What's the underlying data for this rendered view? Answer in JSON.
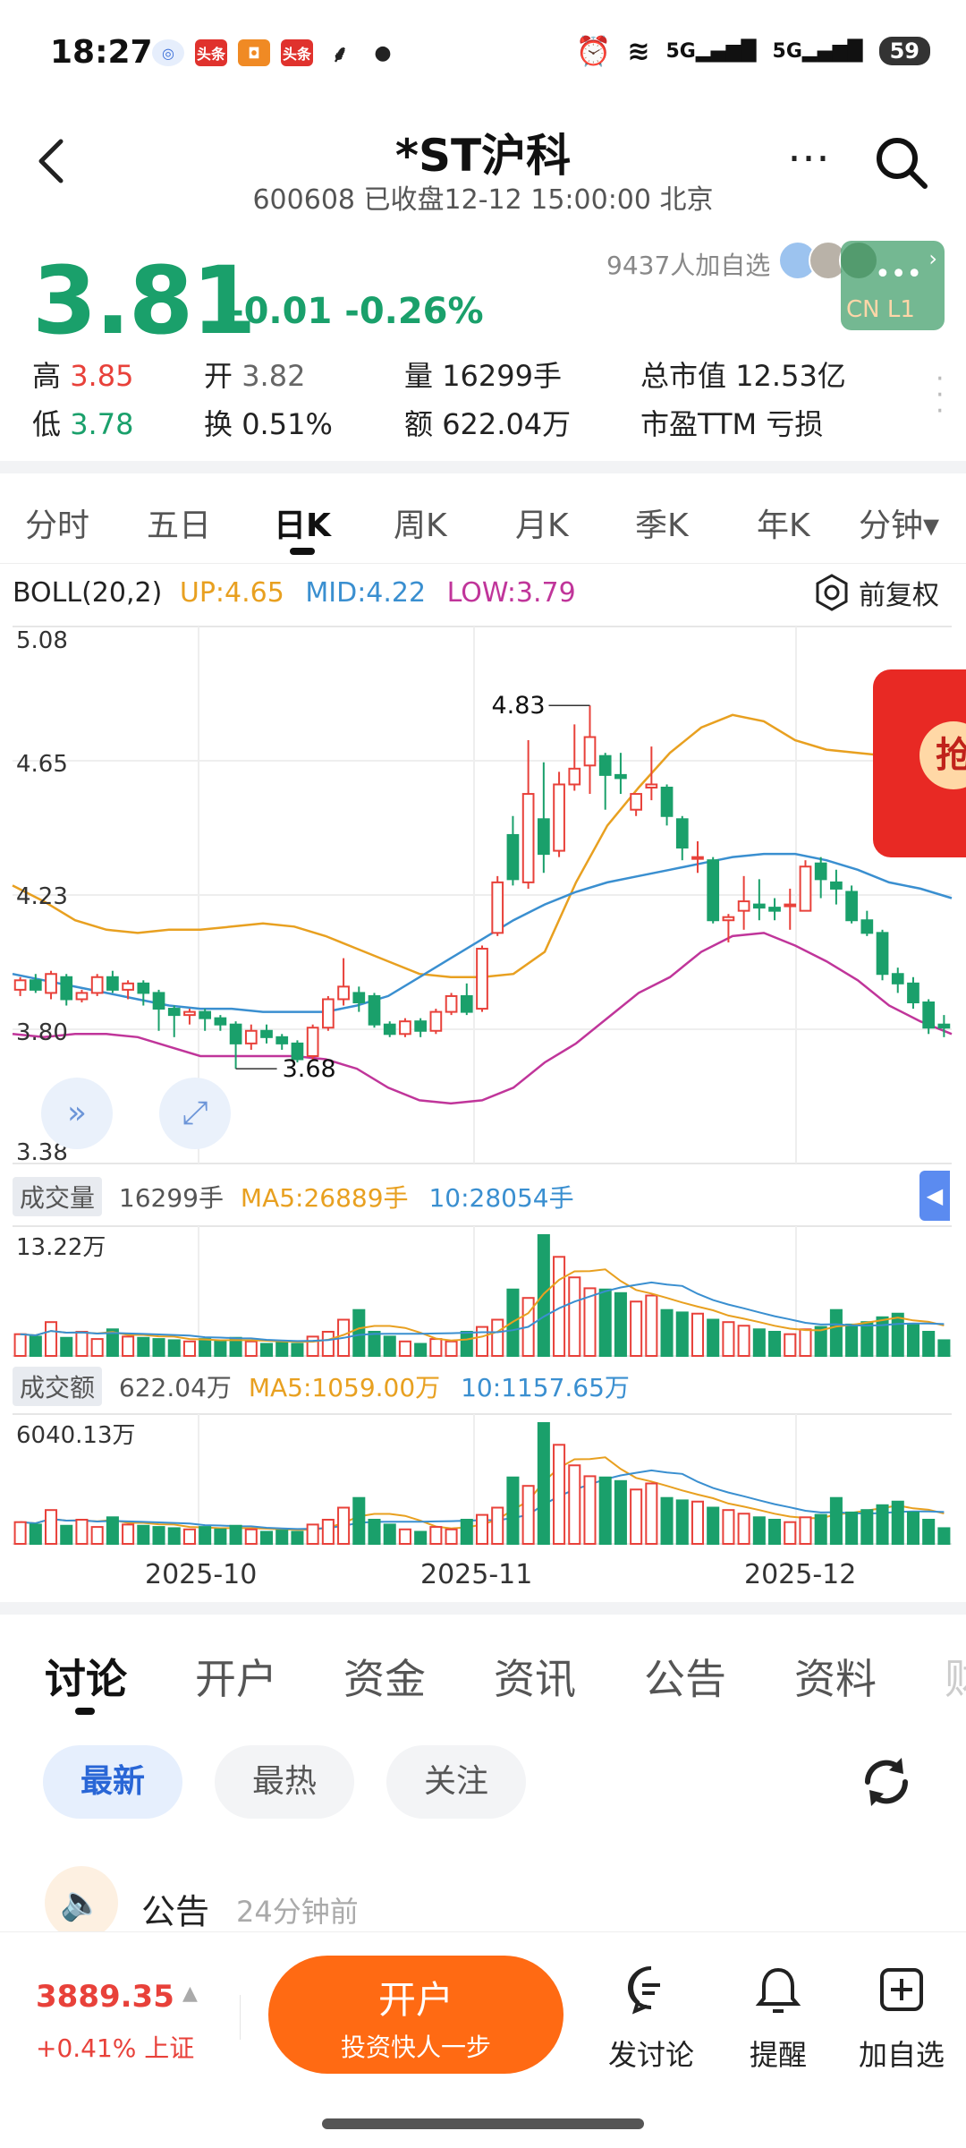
{
  "status_bar": {
    "time": "18:27",
    "app_icons": [
      "头条",
      "头条"
    ],
    "signal": [
      "5G",
      "5G"
    ],
    "battery": "59"
  },
  "header": {
    "title": "*ST沪科",
    "subtitle": "600608 已收盘12-12 15:00:00 北京"
  },
  "quote": {
    "price": "3.81",
    "change": "-0.01 -0.26%",
    "followers": "9437人加自选",
    "widget_label": "CN L1",
    "high_label": "高",
    "high": "3.85",
    "low_label": "低",
    "low": "3.78",
    "open_label": "开",
    "open": "3.82",
    "turnover_label": "换",
    "turnover": "0.51%",
    "volume_label": "量",
    "volume": "16299手",
    "amount_label": "额",
    "amount": "622.04万",
    "mcap_label": "总市值",
    "mcap": "12.53亿",
    "pe_label": "市盈TTM",
    "pe": "亏损"
  },
  "period_tabs": [
    "分时",
    "五日",
    "日K",
    "周K",
    "月K",
    "季K",
    "年K",
    "分钟▾"
  ],
  "chart_header": {
    "boll": "BOLL(20,2)",
    "up": "UP:4.65",
    "mid": "MID:4.22",
    "low": "LOW:3.79",
    "adjust": "前复权"
  },
  "chart_labels": {
    "y_ticks": [
      "5.08",
      "4.65",
      "4.23",
      "3.80",
      "3.38"
    ],
    "max_note": "4.83",
    "min_note": "3.68",
    "vol_title": "成交量",
    "vol_value": "16299手",
    "vol_ma5": "MA5:26889手",
    "vol_ma10": "10:28054手",
    "vol_max": "13.22万",
    "amt_title": "成交额",
    "amt_value": "622.04万",
    "amt_ma5": "MA5:1059.00万",
    "amt_ma10": "10:1157.65万",
    "amt_max": "6040.13万",
    "x_dates": [
      "2025-10",
      "2025-11",
      "2025-12"
    ]
  },
  "colors": {
    "up": "#e8413a",
    "down": "#1aa06b",
    "boll_up": "#e8a020",
    "boll_mid": "#3a8fd0",
    "boll_low": "#c0359a",
    "accent": "#ff6a13"
  },
  "chart_data": {
    "type": "candlestick",
    "indicator": "BOLL(20,2)",
    "ylim": [
      3.38,
      5.08
    ],
    "candles": [
      {
        "o": 3.93,
        "c": 3.96,
        "h": 3.97,
        "l": 3.91
      },
      {
        "o": 3.96,
        "c": 3.93,
        "h": 3.98,
        "l": 3.92
      },
      {
        "o": 3.92,
        "c": 3.98,
        "h": 3.99,
        "l": 3.9
      },
      {
        "o": 3.97,
        "c": 3.9,
        "h": 3.98,
        "l": 3.88
      },
      {
        "o": 3.9,
        "c": 3.92,
        "h": 3.93,
        "l": 3.89
      },
      {
        "o": 3.92,
        "c": 3.97,
        "h": 3.98,
        "l": 3.91
      },
      {
        "o": 3.97,
        "c": 3.93,
        "h": 3.99,
        "l": 3.92
      },
      {
        "o": 3.93,
        "c": 3.95,
        "h": 3.96,
        "l": 3.9
      },
      {
        "o": 3.95,
        "c": 3.92,
        "h": 3.96,
        "l": 3.88
      },
      {
        "o": 3.92,
        "c": 3.87,
        "h": 3.93,
        "l": 3.8
      },
      {
        "o": 3.87,
        "c": 3.85,
        "h": 3.88,
        "l": 3.78
      },
      {
        "o": 3.85,
        "c": 3.86,
        "h": 3.87,
        "l": 3.82
      },
      {
        "o": 3.86,
        "c": 3.84,
        "h": 3.87,
        "l": 3.8
      },
      {
        "o": 3.84,
        "c": 3.82,
        "h": 3.85,
        "l": 3.8
      },
      {
        "o": 3.82,
        "c": 3.76,
        "h": 3.83,
        "l": 3.68
      },
      {
        "o": 3.76,
        "c": 3.8,
        "h": 3.82,
        "l": 3.74
      },
      {
        "o": 3.8,
        "c": 3.78,
        "h": 3.82,
        "l": 3.76
      },
      {
        "o": 3.78,
        "c": 3.76,
        "h": 3.79,
        "l": 3.74
      },
      {
        "o": 3.76,
        "c": 3.71,
        "h": 3.77,
        "l": 3.7
      },
      {
        "o": 3.72,
        "c": 3.81,
        "h": 3.82,
        "l": 3.71
      },
      {
        "o": 3.81,
        "c": 3.9,
        "h": 3.91,
        "l": 3.8
      },
      {
        "o": 3.9,
        "c": 3.94,
        "h": 4.03,
        "l": 3.88
      },
      {
        "o": 3.92,
        "c": 3.89,
        "h": 3.94,
        "l": 3.86
      },
      {
        "o": 3.91,
        "c": 3.82,
        "h": 3.92,
        "l": 3.81
      },
      {
        "o": 3.82,
        "c": 3.79,
        "h": 3.83,
        "l": 3.78
      },
      {
        "o": 3.79,
        "c": 3.83,
        "h": 3.84,
        "l": 3.78
      },
      {
        "o": 3.83,
        "c": 3.8,
        "h": 3.84,
        "l": 3.78
      },
      {
        "o": 3.8,
        "c": 3.86,
        "h": 3.87,
        "l": 3.79
      },
      {
        "o": 3.86,
        "c": 3.91,
        "h": 3.92,
        "l": 3.85
      },
      {
        "o": 3.91,
        "c": 3.86,
        "h": 3.95,
        "l": 3.85
      },
      {
        "o": 3.87,
        "c": 4.06,
        "h": 4.07,
        "l": 3.86
      },
      {
        "o": 4.11,
        "c": 4.27,
        "h": 4.29,
        "l": 4.1
      },
      {
        "o": 4.42,
        "c": 4.28,
        "h": 4.48,
        "l": 4.26
      },
      {
        "o": 4.27,
        "c": 4.55,
        "h": 4.72,
        "l": 4.25
      },
      {
        "o": 4.47,
        "c": 4.36,
        "h": 4.65,
        "l": 4.3
      },
      {
        "o": 4.37,
        "c": 4.58,
        "h": 4.62,
        "l": 4.35
      },
      {
        "o": 4.58,
        "c": 4.63,
        "h": 4.77,
        "l": 4.56
      },
      {
        "o": 4.64,
        "c": 4.73,
        "h": 4.83,
        "l": 4.55
      },
      {
        "o": 4.67,
        "c": 4.61,
        "h": 4.68,
        "l": 4.5
      },
      {
        "o": 4.61,
        "c": 4.6,
        "h": 4.68,
        "l": 4.55
      },
      {
        "o": 4.5,
        "c": 4.55,
        "h": 4.55,
        "l": 4.48
      },
      {
        "o": 4.57,
        "c": 4.58,
        "h": 4.7,
        "l": 4.53
      },
      {
        "o": 4.57,
        "c": 4.48,
        "h": 4.58,
        "l": 4.45
      },
      {
        "o": 4.47,
        "c": 4.38,
        "h": 4.48,
        "l": 4.34
      },
      {
        "o": 4.35,
        "c": 4.35,
        "h": 4.4,
        "l": 4.3
      },
      {
        "o": 4.34,
        "c": 4.15,
        "h": 4.35,
        "l": 4.14
      },
      {
        "o": 4.15,
        "c": 4.16,
        "h": 4.17,
        "l": 4.08
      },
      {
        "o": 4.18,
        "c": 4.21,
        "h": 4.29,
        "l": 4.12
      },
      {
        "o": 4.2,
        "c": 4.19,
        "h": 4.28,
        "l": 4.15
      },
      {
        "o": 4.19,
        "c": 4.18,
        "h": 4.22,
        "l": 4.15
      },
      {
        "o": 4.2,
        "c": 4.2,
        "h": 4.25,
        "l": 4.12
      },
      {
        "o": 4.18,
        "c": 4.32,
        "h": 4.34,
        "l": 4.18
      },
      {
        "o": 4.33,
        "c": 4.28,
        "h": 4.35,
        "l": 4.22
      },
      {
        "o": 4.27,
        "c": 4.25,
        "h": 4.31,
        "l": 4.2
      },
      {
        "o": 4.24,
        "c": 4.15,
        "h": 4.26,
        "l": 4.14
      },
      {
        "o": 4.15,
        "c": 4.11,
        "h": 4.18,
        "l": 4.1
      },
      {
        "o": 4.11,
        "c": 3.98,
        "h": 4.12,
        "l": 3.96
      },
      {
        "o": 3.98,
        "c": 3.95,
        "h": 4.0,
        "l": 3.92
      },
      {
        "o": 3.95,
        "c": 3.89,
        "h": 3.97,
        "l": 3.87
      },
      {
        "o": 3.89,
        "c": 3.81,
        "h": 3.9,
        "l": 3.79
      },
      {
        "o": 3.82,
        "c": 3.81,
        "h": 3.85,
        "l": 3.78
      }
    ],
    "boll_up": [
      4.26,
      4.21,
      4.15,
      4.12,
      4.11,
      4.12,
      4.12,
      4.13,
      4.14,
      4.13,
      4.1,
      4.06,
      4.02,
      3.98,
      3.97,
      3.97,
      3.98,
      4.05,
      4.27,
      4.45,
      4.57,
      4.68,
      4.76,
      4.8,
      4.78,
      4.72,
      4.69,
      4.68,
      4.67,
      4.66,
      4.65
    ],
    "boll_mid": [
      3.98,
      3.96,
      3.94,
      3.92,
      3.9,
      3.88,
      3.87,
      3.87,
      3.86,
      3.86,
      3.86,
      3.88,
      3.91,
      3.97,
      4.03,
      4.09,
      4.15,
      4.2,
      4.24,
      4.27,
      4.29,
      4.31,
      4.33,
      4.35,
      4.36,
      4.36,
      4.34,
      4.31,
      4.27,
      4.25,
      4.22
    ],
    "boll_low": [
      3.79,
      3.78,
      3.79,
      3.79,
      3.78,
      3.75,
      3.72,
      3.72,
      3.72,
      3.72,
      3.71,
      3.68,
      3.62,
      3.58,
      3.57,
      3.58,
      3.62,
      3.7,
      3.76,
      3.84,
      3.92,
      3.97,
      4.05,
      4.1,
      4.11,
      4.07,
      4.02,
      3.96,
      3.88,
      3.83,
      3.79
    ],
    "volume_max": 132200,
    "volume_rel": [
      0.18,
      0.16,
      0.28,
      0.15,
      0.2,
      0.14,
      0.22,
      0.16,
      0.15,
      0.14,
      0.13,
      0.12,
      0.14,
      0.12,
      0.15,
      0.12,
      0.1,
      0.11,
      0.1,
      0.16,
      0.2,
      0.3,
      0.38,
      0.2,
      0.16,
      0.12,
      0.1,
      0.14,
      0.12,
      0.2,
      0.24,
      0.3,
      0.55,
      0.48,
      1.0,
      0.82,
      0.65,
      0.56,
      0.55,
      0.52,
      0.45,
      0.5,
      0.38,
      0.36,
      0.35,
      0.3,
      0.28,
      0.25,
      0.22,
      0.2,
      0.18,
      0.22,
      0.24,
      0.38,
      0.26,
      0.28,
      0.32,
      0.35,
      0.26,
      0.2,
      0.13
    ],
    "amount_max": 60401300
  },
  "content_tabs": [
    "讨论",
    "开户",
    "资金",
    "资讯",
    "公告",
    "资料",
    "财"
  ],
  "filters": [
    "最新",
    "最热",
    "关注"
  ],
  "post": {
    "title": "公告",
    "time": "24分钟前"
  },
  "bottom": {
    "index_value": "3889.35",
    "index_change": "+0.41% 上证",
    "open_account_title": "开户",
    "open_account_sub": "投资快人一步",
    "discuss": "发讨论",
    "remind": "提醒",
    "add": "加自选"
  }
}
